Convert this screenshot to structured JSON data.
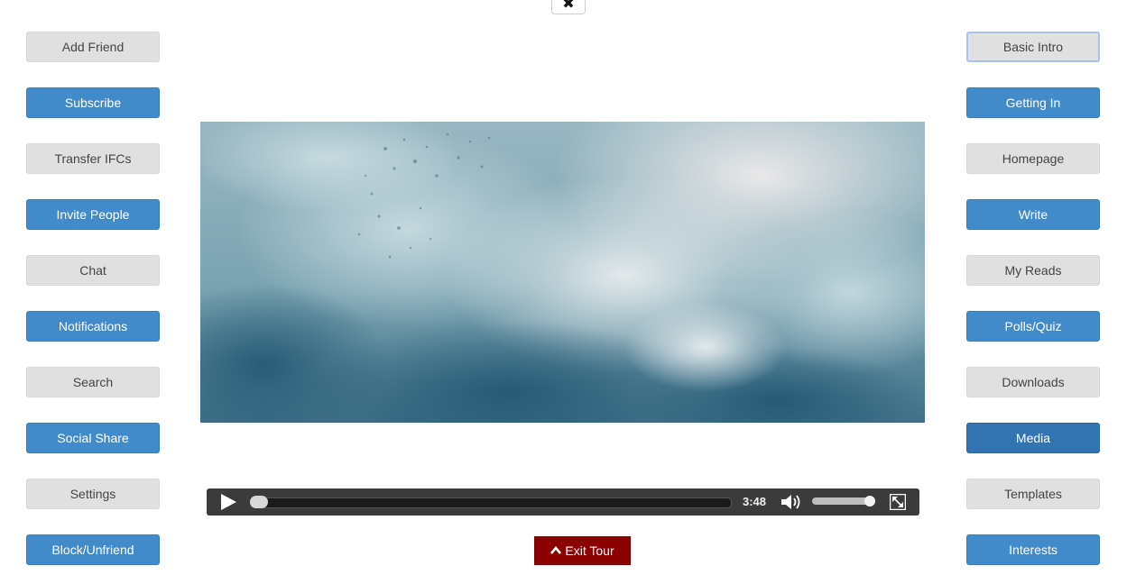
{
  "close_button": {
    "glyph": "✖",
    "icon": "close-icon"
  },
  "left_nav": [
    {
      "label": "Add Friend",
      "style": "gray"
    },
    {
      "label": "Subscribe",
      "style": "blue"
    },
    {
      "label": "Transfer IFCs",
      "style": "gray"
    },
    {
      "label": "Invite People",
      "style": "blue"
    },
    {
      "label": "Chat",
      "style": "gray"
    },
    {
      "label": "Notifications",
      "style": "blue"
    },
    {
      "label": "Search",
      "style": "gray"
    },
    {
      "label": "Social Share",
      "style": "blue"
    },
    {
      "label": "Settings",
      "style": "gray"
    },
    {
      "label": "Block/Unfriend",
      "style": "blue"
    }
  ],
  "right_nav": [
    {
      "label": "Basic Intro",
      "style": "gray",
      "state": "focused"
    },
    {
      "label": "Getting In",
      "style": "blue"
    },
    {
      "label": "Homepage",
      "style": "gray"
    },
    {
      "label": "Write",
      "style": "blue"
    },
    {
      "label": "My Reads",
      "style": "gray"
    },
    {
      "label": "Polls/Quiz",
      "style": "blue"
    },
    {
      "label": "Downloads",
      "style": "gray"
    },
    {
      "label": "Media",
      "style": "blue",
      "state": "active"
    },
    {
      "label": "Templates",
      "style": "gray"
    },
    {
      "label": "Interests",
      "style": "blue"
    }
  ],
  "video": {
    "duration": "3:48",
    "progress": 0.0,
    "volume": 0.9,
    "icons": [
      "play-icon",
      "volume-icon",
      "fullscreen-icon"
    ]
  },
  "exit_tour": {
    "label": "Exit Tour",
    "icon": "chevron-up-icon"
  },
  "colors": {
    "blue_button": "#428bca",
    "gray_button": "#e0e0e0",
    "exit_button": "#8b0000",
    "control_bar": "#3b3b3b"
  }
}
